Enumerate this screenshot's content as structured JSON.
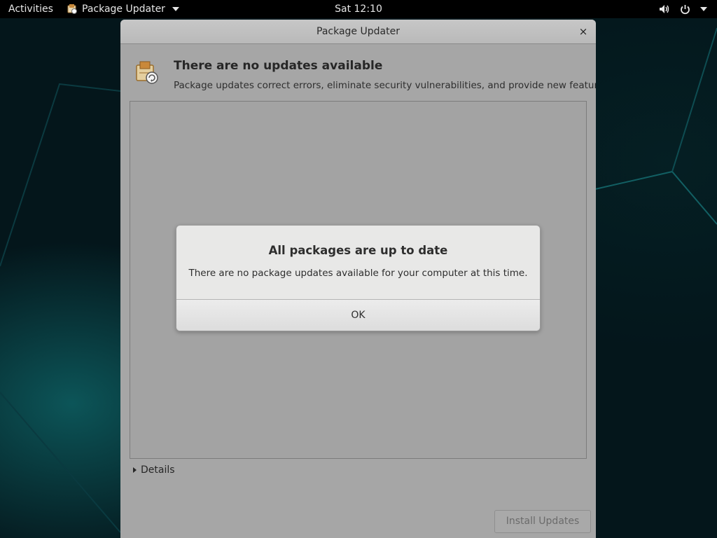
{
  "topbar": {
    "activities_label": "Activities",
    "app_menu_label": "Package Updater",
    "clock": "Sat 12:10",
    "icons": [
      "volume-icon",
      "power-icon",
      "chevron-down-icon"
    ]
  },
  "window": {
    "title": "Package Updater",
    "close_glyph": "×",
    "heading": "There are no updates available",
    "description": "Package updates correct errors, eliminate security vulnerabilities, and provide new features.",
    "details_label": "Details",
    "install_button_label": "Install Updates",
    "install_button_enabled": false
  },
  "dialog": {
    "title": "All packages are up to date",
    "message": "There are no package updates available for your computer at this time.",
    "ok_label": "OK"
  },
  "colors": {
    "topbar_bg": "#000000",
    "window_bg": "#a6a6a6",
    "dialog_bg": "#e8e8e7",
    "wallpaper_accent": "#0b6f6f"
  }
}
